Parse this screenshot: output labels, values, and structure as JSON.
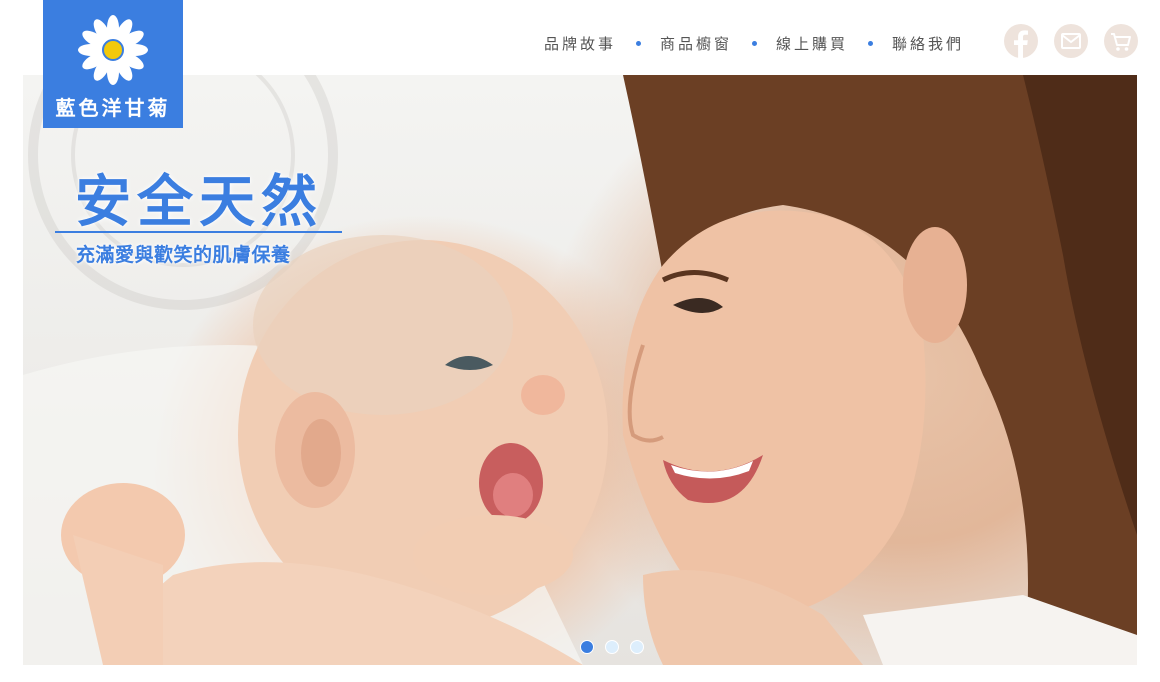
{
  "brand": {
    "name": "藍色洋甘菊",
    "color": "#3b7ee0"
  },
  "nav": {
    "items": [
      {
        "label": "品牌故事"
      },
      {
        "label": "商品櫥窗"
      },
      {
        "label": "線上購買"
      },
      {
        "label": "聯絡我們"
      }
    ]
  },
  "social": {
    "icons": [
      "facebook-icon",
      "mail-icon",
      "cart-icon"
    ],
    "color": "#eee3dc"
  },
  "hero": {
    "title": "安全天然",
    "subtitle": "充滿愛與歡笑的肌膚保養",
    "slides_total": 3,
    "active_slide": 1
  }
}
